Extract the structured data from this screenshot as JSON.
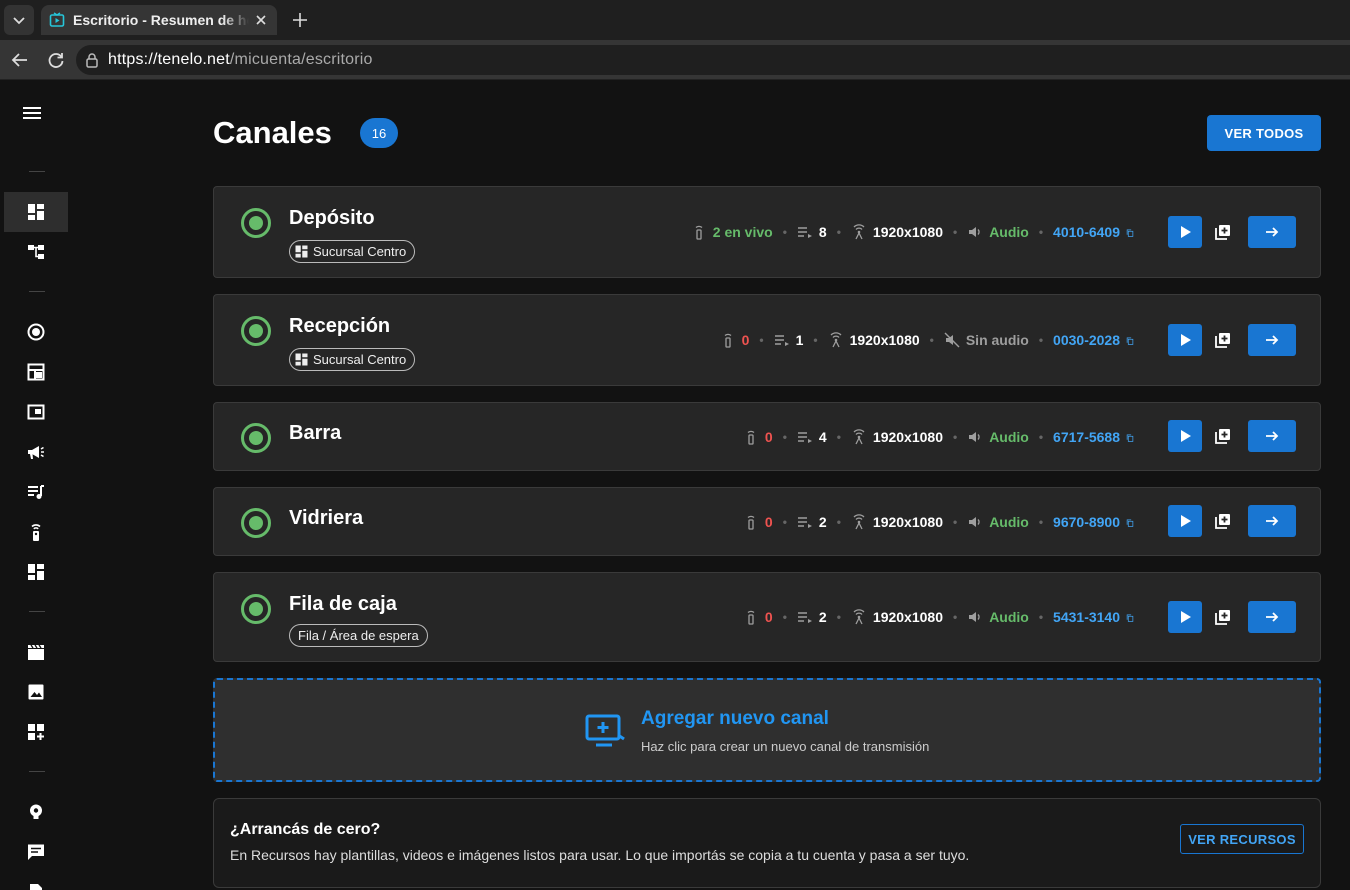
{
  "browser": {
    "tab_title": "Escritorio - Resumen de herramientas",
    "url_host": "https://tenelo.net",
    "url_path": "/micuenta/escritorio"
  },
  "header": {
    "title": "Canales",
    "count": "16",
    "ver_todos": "VER TODOS"
  },
  "channels": [
    {
      "name": "Depósito",
      "tag": "Sucursal Centro",
      "live": "2 en vivo",
      "queue": "8",
      "resolution": "1920x1080",
      "audio": "Audio",
      "code": "4010-6409"
    },
    {
      "name": "Recepción",
      "tag": "Sucursal Centro",
      "live": "0",
      "queue": "1",
      "resolution": "1920x1080",
      "audio": "Sin audio",
      "code": "0030-2028"
    },
    {
      "name": "Barra",
      "live": "0",
      "queue": "4",
      "resolution": "1920x1080",
      "audio": "Audio",
      "code": "6717-5688"
    },
    {
      "name": "Vidriera",
      "live": "0",
      "queue": "2",
      "resolution": "1920x1080",
      "audio": "Audio",
      "code": "9670-8900"
    },
    {
      "name": "Fila de caja",
      "tag": "Fila / Área de espera",
      "live": "0",
      "queue": "2",
      "resolution": "1920x1080",
      "audio": "Audio",
      "code": "5431-3140"
    }
  ],
  "add_channel": {
    "title": "Agregar nuevo canal",
    "subtitle": "Haz clic para crear un nuevo canal de transmisión"
  },
  "resources": {
    "title": "¿Arrancás de cero?",
    "text": "En Recursos hay plantillas, videos e imágenes listos para usar. Lo que importás se copia a tu cuenta y pasa a ser tuyo.",
    "button": "VER RECURSOS"
  },
  "colors": {
    "accent": "#1976d2",
    "live_green": "#66bb6a",
    "zero_red": "#ef5350",
    "link_blue": "#42a5f5"
  }
}
